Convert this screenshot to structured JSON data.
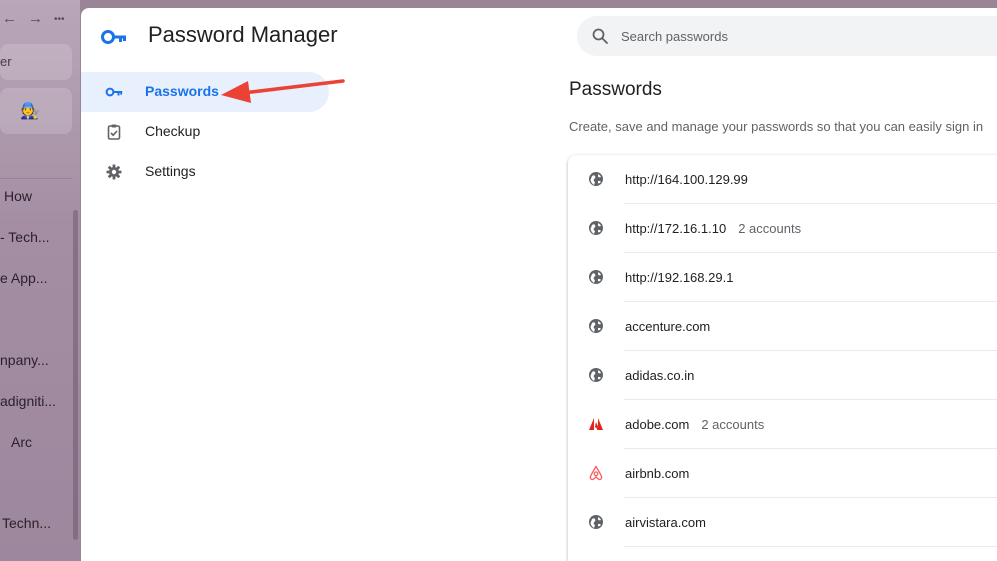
{
  "arc_sidebar": {
    "nav_back": "←",
    "nav_forward": "→",
    "nav_more": "•••",
    "search_fragment": "er",
    "pinned_emoji": "🧑‍🔧",
    "items": [
      {
        "label": "How"
      },
      {
        "label": "- Tech..."
      },
      {
        "label": "e App..."
      },
      {
        "label": "npany..."
      },
      {
        "label": "adigniti..."
      },
      {
        "label": "Arc"
      },
      {
        "label": "Techn..."
      }
    ]
  },
  "header": {
    "title": "Password Manager",
    "logo_icon": "key-icon",
    "search_placeholder": "Search passwords"
  },
  "nav": [
    {
      "label": "Passwords",
      "icon": "key-icon",
      "active": true
    },
    {
      "label": "Checkup",
      "icon": "clipboard-check-icon",
      "active": false
    },
    {
      "label": "Settings",
      "icon": "gear-icon",
      "active": false
    }
  ],
  "content": {
    "title": "Passwords",
    "description": "Create, save and manage your passwords so that you can easily sign in"
  },
  "passwords": [
    {
      "site": "http://164.100.129.99",
      "accounts": "",
      "icon": "globe-icon"
    },
    {
      "site": "http://172.16.1.10",
      "accounts": "2 accounts",
      "icon": "globe-icon"
    },
    {
      "site": "http://192.168.29.1",
      "accounts": "",
      "icon": "globe-icon"
    },
    {
      "site": "accenture.com",
      "accounts": "",
      "icon": "globe-icon"
    },
    {
      "site": "adidas.co.in",
      "accounts": "",
      "icon": "globe-icon"
    },
    {
      "site": "adobe.com",
      "accounts": "2 accounts",
      "icon": "adobe-icon"
    },
    {
      "site": "airbnb.com",
      "accounts": "",
      "icon": "airbnb-icon"
    },
    {
      "site": "airvistara.com",
      "accounts": "",
      "icon": "globe-icon"
    }
  ],
  "colors": {
    "accent": "#1a73e8",
    "active_bg": "#e8f0fe",
    "arrow": "#ea4335",
    "adobe": "#e1251b",
    "airbnb": "#ff5a5f"
  }
}
